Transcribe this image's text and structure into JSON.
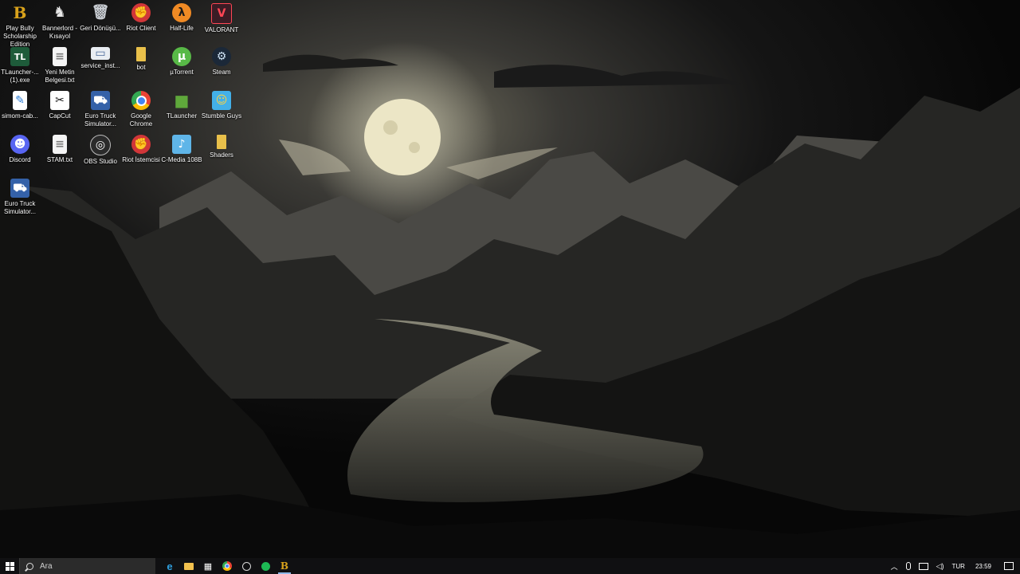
{
  "desktop": {
    "icons": [
      {
        "label": "Play Bully Scholarship Edition",
        "icon": "bully-icon",
        "glyph": "B",
        "bg": "transparent",
        "fg": "#d9a21b"
      },
      {
        "label": "Bannerlord - Kısayol",
        "icon": "bannerlord-icon",
        "glyph": "♞",
        "bg": "transparent",
        "fg": "#e8e8e8"
      },
      {
        "label": "Geri Dönüşü...",
        "icon": "recycle-bin-icon",
        "glyph": "🗑",
        "bg": "transparent",
        "fg": "#c8ccd2"
      },
      {
        "label": "Riot Client",
        "icon": "riot-client-icon",
        "glyph": "✊",
        "bg": "#d13639",
        "fg": "#ffffff"
      },
      {
        "label": "Half-Life",
        "icon": "half-life-icon",
        "glyph": "λ",
        "bg": "#f08a24",
        "fg": "#1a1a1a"
      },
      {
        "label": "VALORANT",
        "icon": "valorant-icon",
        "glyph": "V",
        "bg": "#3b1c25",
        "fg": "#ff4655"
      },
      {
        "label": "TLauncher-... (1).exe",
        "icon": "tlauncher-exe-icon",
        "glyph": "TL",
        "bg": "#1e5b3a",
        "fg": "#ffffff"
      },
      {
        "label": "Yeni Metin Belgesi.txt",
        "icon": "text-file-icon",
        "glyph": "≡",
        "bg": "#f4f4f4",
        "fg": "#7a7a7a"
      },
      {
        "label": "service_inst...",
        "icon": "installer-icon",
        "glyph": "▭",
        "bg": "#e9edf2",
        "fg": "#4a6a9a"
      },
      {
        "label": "bot",
        "icon": "folder-icon",
        "glyph": "",
        "bg": "#e9c04a",
        "fg": "#e9c04a"
      },
      {
        "label": "µTorrent",
        "icon": "utorrent-icon",
        "glyph": "µ",
        "bg": "#58b947",
        "fg": "#ffffff"
      },
      {
        "label": "Steam",
        "icon": "steam-icon",
        "glyph": "⚙",
        "bg": "#1b2838",
        "fg": "#cfe3f4"
      },
      {
        "label": "simom-cab...",
        "icon": "file-icon",
        "glyph": "✎",
        "bg": "#ffffff",
        "fg": "#2a7bd4"
      },
      {
        "label": "CapCut",
        "icon": "capcut-icon",
        "glyph": "✂",
        "bg": "#ffffff",
        "fg": "#111111"
      },
      {
        "label": "Euro Truck Simulator...",
        "icon": "euro-truck-icon",
        "glyph": "⛟",
        "bg": "#3461a8",
        "fg": "#ffffff"
      },
      {
        "label": "Google Chrome",
        "icon": "chrome-icon",
        "glyph": "◉",
        "bg": "transparent",
        "fg": "#4285f4"
      },
      {
        "label": "TLauncher",
        "icon": "tlauncher-icon",
        "glyph": "■",
        "bg": "transparent",
        "fg": "#5fa83b"
      },
      {
        "label": "Stumble Guys",
        "icon": "stumble-guys-icon",
        "glyph": "☺",
        "bg": "#43b0e8",
        "fg": "#ffd23f"
      },
      {
        "label": "Discord",
        "icon": "discord-icon",
        "glyph": "☻",
        "bg": "#5865f2",
        "fg": "#ffffff"
      },
      {
        "label": "STAM.txt",
        "icon": "text-file-icon",
        "glyph": "≡",
        "bg": "#f4f4f4",
        "fg": "#7a7a7a"
      },
      {
        "label": "OBS Studio",
        "icon": "obs-icon",
        "glyph": "◎",
        "bg": "#2b2b2b",
        "fg": "#ffffff"
      },
      {
        "label": "Riot İstemcisi",
        "icon": "riot-client-icon",
        "glyph": "✊",
        "bg": "#d13639",
        "fg": "#ffffff"
      },
      {
        "label": "C-Media 108B",
        "icon": "c-media-icon",
        "glyph": "♪",
        "bg": "#5fb5e8",
        "fg": "#ffffff"
      },
      {
        "label": "Shaders",
        "icon": "folder-icon",
        "glyph": "",
        "bg": "#e9c04a",
        "fg": "#e9c04a"
      },
      {
        "label": "Euro Truck Simulator...",
        "icon": "euro-truck-icon",
        "glyph": "⛟",
        "bg": "#3461a8",
        "fg": "#ffffff"
      }
    ]
  },
  "taskbar": {
    "search_placeholder": "Ara",
    "apps": [
      {
        "name": "edge-icon",
        "glyph": "e",
        "color": "#2fa0e0"
      },
      {
        "name": "file-explorer-icon",
        "glyph": "▬",
        "color": "#f2c14e"
      },
      {
        "name": "store-icon",
        "glyph": "▦",
        "color": "#ffffff"
      },
      {
        "name": "chrome-icon",
        "glyph": "◉",
        "color": "#e8453c"
      },
      {
        "name": "obs-icon",
        "glyph": "◎",
        "color": "#d8d8d8"
      },
      {
        "name": "spotify-icon",
        "glyph": "●",
        "color": "#1db954"
      },
      {
        "name": "bully-icon",
        "glyph": "B",
        "color": "#d9a21b"
      }
    ],
    "tray": {
      "language": "TUR",
      "time": "23:59"
    }
  }
}
